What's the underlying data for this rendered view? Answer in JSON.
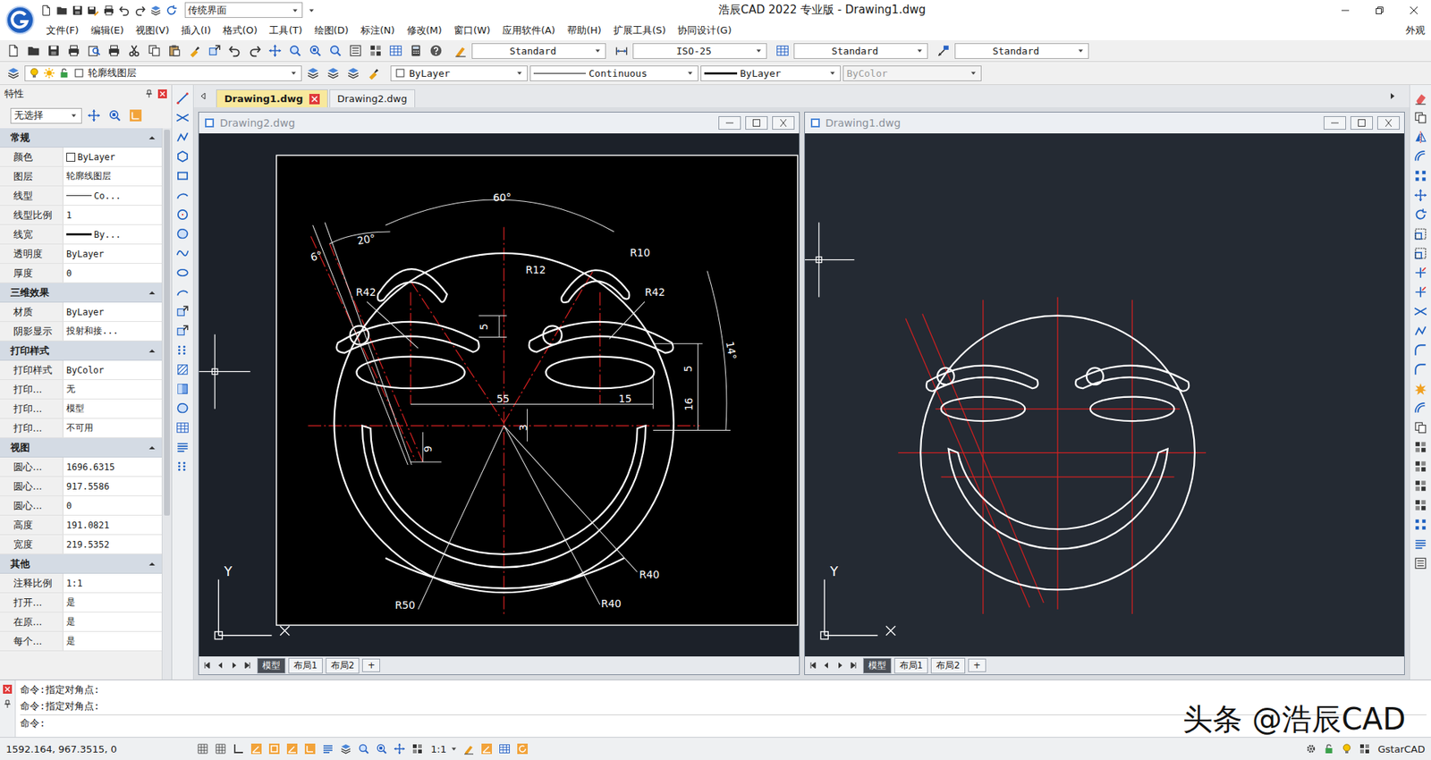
{
  "window": {
    "title": "浩辰CAD 2022 专业版 - Drawing1.dwg",
    "workspace": "传统界面"
  },
  "menu": [
    "文件(F)",
    "编辑(E)",
    "视图(V)",
    "插入(I)",
    "格式(O)",
    "工具(T)",
    "绘图(D)",
    "标注(N)",
    "修改(M)",
    "窗口(W)",
    "应用软件(A)",
    "帮助(H)",
    "扩展工具(S)",
    "协同设计(G)"
  ],
  "menu_right": "外观",
  "style_dropdowns": [
    "Standard",
    "ISO-25",
    "Standard",
    "Standard"
  ],
  "layer_bar": {
    "layer": "轮廓线图层",
    "color": "ByLayer",
    "linetype": "Continuous",
    "lineweight": "ByLayer",
    "plotstyle": {
      "value": "ByColor",
      "disabled": true
    }
  },
  "properties": {
    "title": "特性",
    "selection": "无选择",
    "sections": [
      {
        "title": "常规",
        "expanded": true,
        "rows": [
          {
            "label": "颜色",
            "value": "ByLayer",
            "kind": "color"
          },
          {
            "label": "图层",
            "value": "轮廓线图层",
            "kind": "text"
          },
          {
            "label": "线型",
            "value": "Co...",
            "kind": "line"
          },
          {
            "label": "线型比例",
            "value": "1",
            "kind": "text"
          },
          {
            "label": "线宽",
            "value": "By...",
            "kind": "thickline"
          },
          {
            "label": "透明度",
            "value": "ByLayer",
            "kind": "text"
          },
          {
            "label": "厚度",
            "value": "0",
            "kind": "text"
          }
        ]
      },
      {
        "title": "三维效果",
        "expanded": true,
        "rows": [
          {
            "label": "材质",
            "value": "ByLayer",
            "kind": "text"
          },
          {
            "label": "阴影显示",
            "value": "投射和接...",
            "kind": "text"
          }
        ]
      },
      {
        "title": "打印样式",
        "expanded": true,
        "rows": [
          {
            "label": "打印样式",
            "value": "ByColor",
            "kind": "text"
          },
          {
            "label": "打印...",
            "value": "无",
            "kind": "text"
          },
          {
            "label": "打印...",
            "value": "模型",
            "kind": "text"
          },
          {
            "label": "打印...",
            "value": "不可用",
            "kind": "text"
          }
        ]
      },
      {
        "title": "视图",
        "expanded": true,
        "rows": [
          {
            "label": "圆心...",
            "value": "1696.6315",
            "kind": "text"
          },
          {
            "label": "圆心...",
            "value": "917.5586",
            "kind": "text"
          },
          {
            "label": "圆心...",
            "value": "0",
            "kind": "text"
          },
          {
            "label": "高度",
            "value": "191.0821",
            "kind": "text"
          },
          {
            "label": "宽度",
            "value": "219.5352",
            "kind": "text"
          }
        ]
      },
      {
        "title": "其他",
        "expanded": true,
        "rows": [
          {
            "label": "注释比例",
            "value": "1:1",
            "kind": "text"
          },
          {
            "label": "打开...",
            "value": "是",
            "kind": "text"
          },
          {
            "label": "在原...",
            "value": "是",
            "kind": "text"
          },
          {
            "label": "每个...",
            "value": "是",
            "kind": "text"
          }
        ]
      }
    ]
  },
  "doc_tabs": [
    {
      "label": "Drawing1.dwg",
      "selected": true
    },
    {
      "label": "Drawing2.dwg",
      "selected": false
    }
  ],
  "viewports": [
    {
      "title": "Drawing2.dwg",
      "kind": "annotated",
      "axis_label": "Y",
      "add_tab": "+",
      "layout_tabs": [
        {
          "label": "模型",
          "selected": true
        },
        {
          "label": "布局1",
          "selected": false
        },
        {
          "label": "布局2",
          "selected": false
        }
      ]
    },
    {
      "title": "Drawing1.dwg",
      "kind": "plain",
      "axis_label": "Y",
      "add_tab": "+",
      "layout_tabs": [
        {
          "label": "模型",
          "selected": true
        },
        {
          "label": "布局1",
          "selected": false
        },
        {
          "label": "布局2",
          "selected": false
        }
      ]
    }
  ],
  "dimension_labels": [
    "60°",
    "20°",
    "6°",
    "R10",
    "R12",
    "R42",
    "R42",
    "5",
    "5",
    "14°",
    "55",
    "15",
    "16",
    "3",
    "9",
    "R40",
    "R50",
    "R40"
  ],
  "command": {
    "lines": [
      "命令:指定对角点:",
      "命令:指定对角点:",
      "命令:"
    ]
  },
  "watermark": "头条 @浩辰CAD",
  "status_bar": {
    "coords": "1592.164, 967.3515, 0",
    "scale": "1:1",
    "brand": "GstarCAD"
  }
}
